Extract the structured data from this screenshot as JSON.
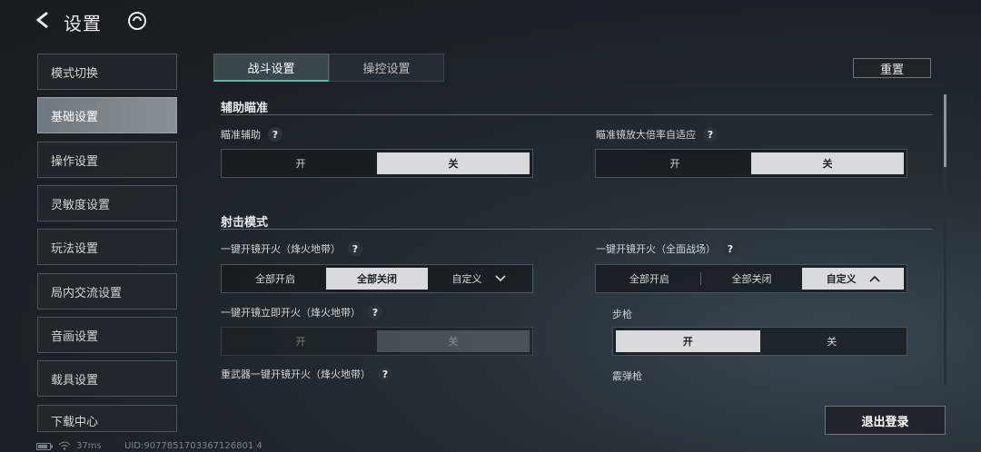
{
  "header": {
    "title": "设置",
    "back_icon": "back-arrow-icon",
    "logo_icon": "game-logo-icon"
  },
  "sidebar": {
    "items": [
      {
        "label": "模式切换",
        "active": false
      },
      {
        "label": "基础设置",
        "active": true
      },
      {
        "label": "操作设置",
        "active": false
      },
      {
        "label": "灵敏度设置",
        "active": false
      },
      {
        "label": "玩法设置",
        "active": false
      },
      {
        "label": "局内交流设置",
        "active": false
      },
      {
        "label": "音画设置",
        "active": false
      },
      {
        "label": "载具设置",
        "active": false
      },
      {
        "label": "下载中心",
        "active": false
      }
    ]
  },
  "tabs": [
    {
      "label": "战斗设置",
      "active": true
    },
    {
      "label": "操控设置",
      "active": false
    }
  ],
  "reset_label": "重置",
  "sections": {
    "aim_assist": {
      "title": "辅助瞄准",
      "aim_assist_label": "瞄准辅助",
      "aim_assist_options": [
        "开",
        "关"
      ],
      "scope_adapt_label": "瞄准镜放大倍率自适应",
      "scope_adapt_options": [
        "开",
        "关"
      ]
    },
    "fire_mode": {
      "title": "射击模式",
      "one_key_fire_ff_label": "一键开镜开火（烽火地带）",
      "one_key_fire_ff_options": [
        "全部开启",
        "全部关闭",
        "自定义"
      ],
      "one_key_fire_war_label": "一键开镜开火（全面战场）",
      "one_key_fire_war_options": [
        "全部开启",
        "全部关闭",
        "自定义"
      ],
      "instant_fire_ff_label": "一键开镜立即开火（烽火地带）",
      "instant_fire_ff_options": [
        "开",
        "关"
      ],
      "rifle_label": "步枪",
      "rifle_options": [
        "开",
        "关"
      ],
      "heavy_weapon_label": "重武器一键开镜开火（烽火地带）",
      "shotgun_label": "霰弹枪"
    }
  },
  "help_glyph": "?",
  "logout_label": "退出登录",
  "status_bar": {
    "ping": "37ms",
    "uid": "UID:9077851703367126801 4"
  }
}
